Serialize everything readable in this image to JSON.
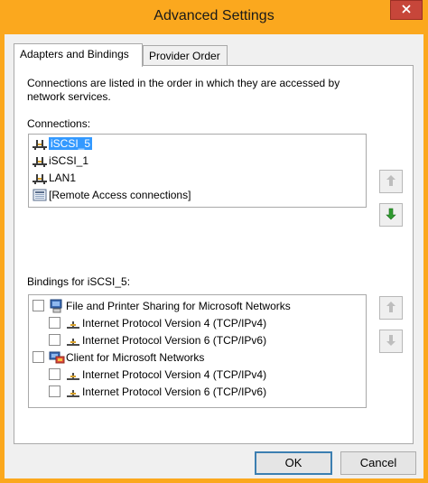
{
  "window": {
    "title": "Advanced Settings"
  },
  "tabs": [
    {
      "label": "Adapters and Bindings",
      "active": true
    },
    {
      "label": "Provider Order",
      "active": false
    }
  ],
  "panel": {
    "description": "Connections are listed in the order in which they are accessed by network services.",
    "connections_label": "Connections:",
    "connections": [
      {
        "label": "iSCSI_5",
        "selected": true,
        "icon": "network-adapter-icon"
      },
      {
        "label": "iSCSI_1",
        "selected": false,
        "icon": "network-adapter-icon"
      },
      {
        "label": "LAN1",
        "selected": false,
        "icon": "network-adapter-icon"
      },
      {
        "label": "[Remote Access connections]",
        "selected": false,
        "icon": "remote-access-icon"
      }
    ],
    "bindings_label": "Bindings for iSCSI_5:",
    "bindings": [
      {
        "label": "File and Printer Sharing for Microsoft Networks",
        "level": 0,
        "icon": "file-printer-sharing-icon",
        "checked": false
      },
      {
        "label": "Internet Protocol Version 4 (TCP/IPv4)",
        "level": 1,
        "icon": "protocol-icon",
        "checked": false
      },
      {
        "label": "Internet Protocol Version 6 (TCP/IPv6)",
        "level": 1,
        "icon": "protocol-icon",
        "checked": false
      },
      {
        "label": "Client for Microsoft Networks",
        "level": 0,
        "icon": "network-client-icon",
        "checked": false
      },
      {
        "label": "Internet Protocol Version 4 (TCP/IPv4)",
        "level": 1,
        "icon": "protocol-icon",
        "checked": false
      },
      {
        "label": "Internet Protocol Version 6 (TCP/IPv6)",
        "level": 1,
        "icon": "protocol-icon",
        "checked": false
      }
    ]
  },
  "buttons": {
    "ok": "OK",
    "cancel": "Cancel"
  },
  "colors": {
    "title_bar": "#fba81e",
    "selection": "#3399ff",
    "close_button": "#c7463a"
  }
}
